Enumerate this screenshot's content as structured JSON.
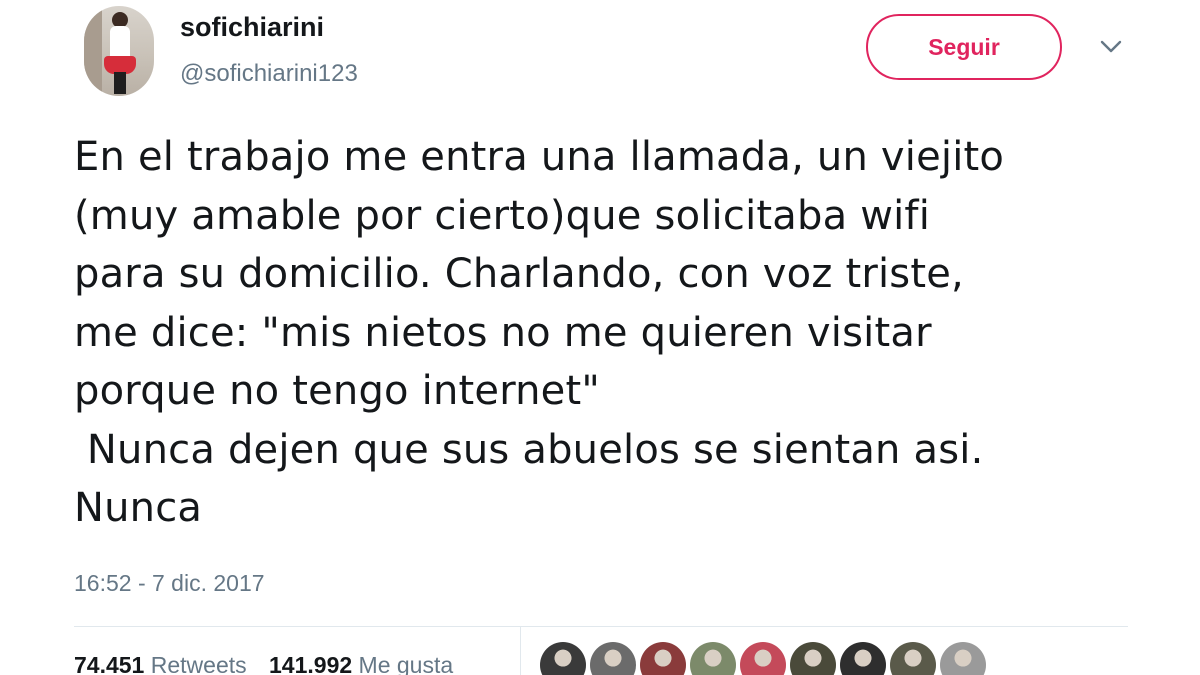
{
  "user": {
    "display_name": "sofichiarini",
    "handle": "@sofichiarini123"
  },
  "follow_button": {
    "label": "Seguir",
    "color": "#e0245e"
  },
  "menu_icon": "chevron-down-icon",
  "tweet": {
    "text": "En el trabajo me entra una llamada, un viejito\n(muy amable por cierto)que solicitaba wifi\npara su domicilio. Charlando, con voz triste,\nme dice: \"mis nietos no me quieren visitar\nporque no tengo internet\"\n Nunca dejen que sus abuelos se sientan asi.\nNunca",
    "timestamp": "16:52 - 7 dic. 2017"
  },
  "stats": {
    "retweets_count": "74.451",
    "retweets_label": "Retweets",
    "likes_count": "141.992",
    "likes_label": "Me gusta"
  },
  "liker_avatars": [
    {
      "name": "liker-avatar-1",
      "color": "#3a3a3a"
    },
    {
      "name": "liker-avatar-2",
      "color": "#6b6b6b"
    },
    {
      "name": "liker-avatar-3",
      "color": "#8a3b3b"
    },
    {
      "name": "liker-avatar-4",
      "color": "#7c8a6a"
    },
    {
      "name": "liker-avatar-5",
      "color": "#c44a5a"
    },
    {
      "name": "liker-avatar-6",
      "color": "#4a4a3a"
    },
    {
      "name": "liker-avatar-7",
      "color": "#2e2e2e"
    },
    {
      "name": "liker-avatar-8",
      "color": "#5a5a4a"
    },
    {
      "name": "liker-avatar-9",
      "color": "#9a9a9a"
    }
  ],
  "colors": {
    "text_primary": "#14171a",
    "text_secondary": "#657786",
    "divider": "#e1e8ed"
  }
}
